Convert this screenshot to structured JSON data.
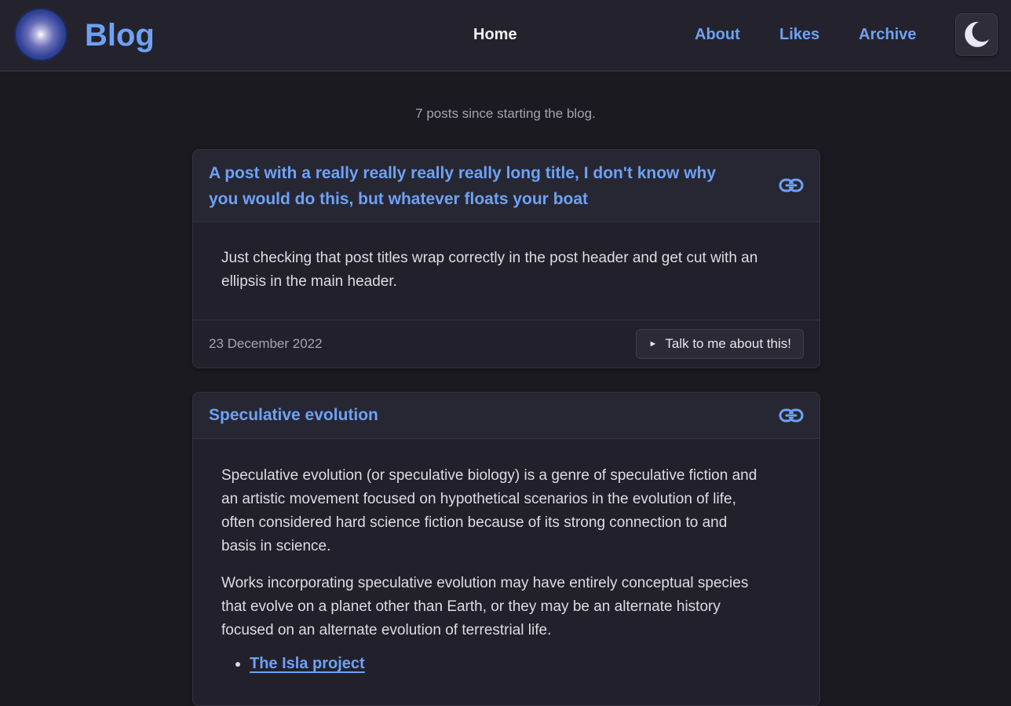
{
  "header": {
    "brand": "Blog",
    "nav": [
      {
        "label": "Home",
        "active": true
      },
      {
        "label": "About"
      },
      {
        "label": "Likes"
      },
      {
        "label": "Archive"
      }
    ],
    "theme_icon": "moon-icon"
  },
  "summary": "7 posts since starting the blog.",
  "posts": [
    {
      "title_line1": "A post with a really really really really long title, I don't know why",
      "title_line2": "you would do this, but whatever floats your boat",
      "body_line1": "Just checking that post titles wrap correctly in the post header and get cut with an",
      "body_line2": "ellipsis in the main header.",
      "date": "23 December 2022",
      "action_label": "Talk to me about this!"
    },
    {
      "title": "Speculative evolution",
      "para1": [
        "Speculative evolution (or speculative biology) is a genre of speculative fiction and",
        "an artistic movement focused on hypothetical scenarios in the evolution of life,",
        "often considered hard science fiction because of its strong connection to and",
        "basis in science."
      ],
      "para2": [
        "Works incorporating speculative evolution may have entirely conceptual species",
        "that evolve on a planet other than Earth, or they may be an alternate history",
        "focused on an alternate evolution of terrestrial life."
      ],
      "links": [
        "The Isla project"
      ]
    }
  ],
  "colors": {
    "accent": "#6ea1f5",
    "background": "#1b1a20",
    "card": "#22212b"
  }
}
